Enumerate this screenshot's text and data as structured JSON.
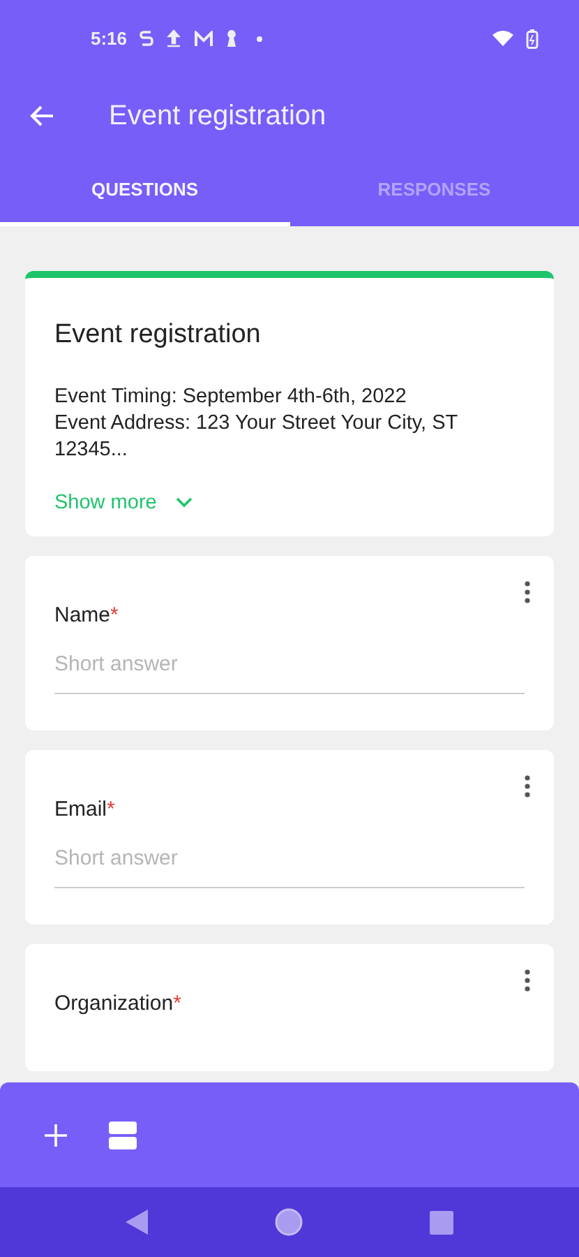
{
  "status_bar": {
    "time": "5:16"
  },
  "app_bar": {
    "title": "Event registration"
  },
  "tabs": [
    {
      "label": "QUESTIONS",
      "selected": true
    },
    {
      "label": "RESPONSES",
      "selected": false
    }
  ],
  "form_header": {
    "title": "Event registration",
    "description": "Event Timing: September 4th-6th, 2022\nEvent Address: 123 Your Street Your City, ST 12345...",
    "show_more": "Show more"
  },
  "questions": [
    {
      "title": "Name",
      "required_mark": "*",
      "placeholder": "Short answer"
    },
    {
      "title": "Email",
      "required_mark": "*",
      "placeholder": "Short answer"
    },
    {
      "title": "Organization",
      "required_mark": "*"
    }
  ]
}
